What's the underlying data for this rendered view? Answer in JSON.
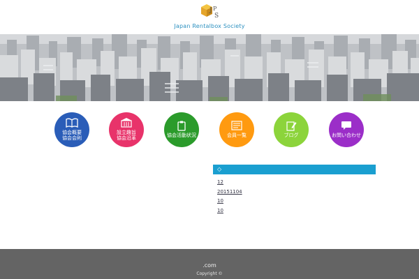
{
  "header": {
    "site_title": "Japan Rentalbox Society",
    "logo_text": "JPS",
    "logo_icon": "box-logo-icon"
  },
  "banner": {
    "image_name": "city-skyline"
  },
  "nav": {
    "items": [
      {
        "label": "協会概要\n協会会則",
        "icon": "open-book-icon",
        "color": "#2a5db8"
      },
      {
        "label": "設立趣旨\n協会沿革",
        "icon": "building-icon",
        "color": "#e8336a"
      },
      {
        "label": "協会活動状況",
        "icon": "clipboard-icon",
        "color": "#2b9b2b"
      },
      {
        "label": "会員一覧",
        "icon": "document-list-icon",
        "color": "#ff9a10"
      },
      {
        "label": "ブログ",
        "icon": "pen-edit-icon",
        "color": "#8cd43b"
      },
      {
        "label": "お問い合わせ",
        "icon": "speech-bubble-icon",
        "color": "#9b2ec8"
      }
    ]
  },
  "news": {
    "heading": "◇",
    "items": [
      "12",
      "20151104",
      "10",
      "10"
    ]
  },
  "footer": {
    "domain": ".com",
    "copyright": "Copyright ©"
  },
  "colors": {
    "accent": "#1a9fd0",
    "footer_bg": "#646464",
    "title": "#2a8fbf"
  }
}
